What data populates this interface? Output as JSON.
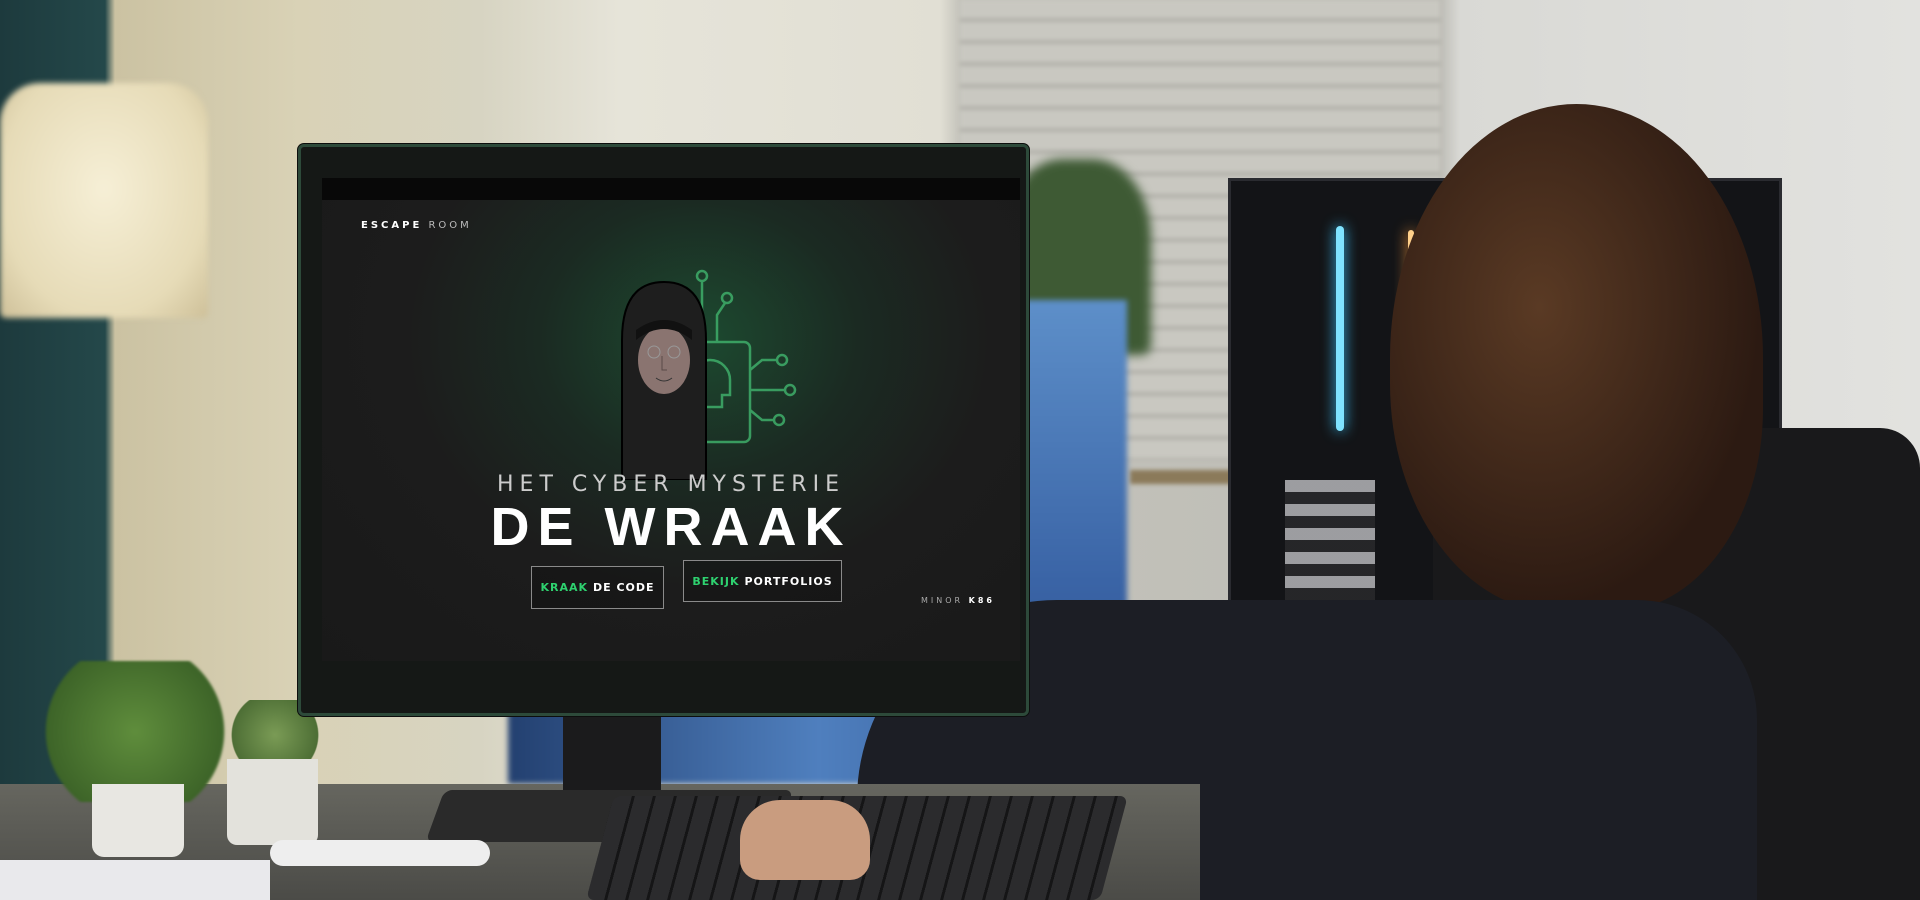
{
  "site": {
    "brand": {
      "bold": "ESCAPE",
      "light": "ROOM"
    },
    "subtitle": "HET CYBER MYSTERIE",
    "title": "DE WRAAK",
    "buttons": [
      {
        "highlight": "KRAAK",
        "label": "DE CODE"
      },
      {
        "highlight": "BEKIJK",
        "label": "PORTFOLIOS"
      }
    ],
    "footer": {
      "light": "MINOR",
      "bold": "K86"
    }
  },
  "colors": {
    "accent": "#2ed16f",
    "screen_bg": "#1c1c1c"
  }
}
